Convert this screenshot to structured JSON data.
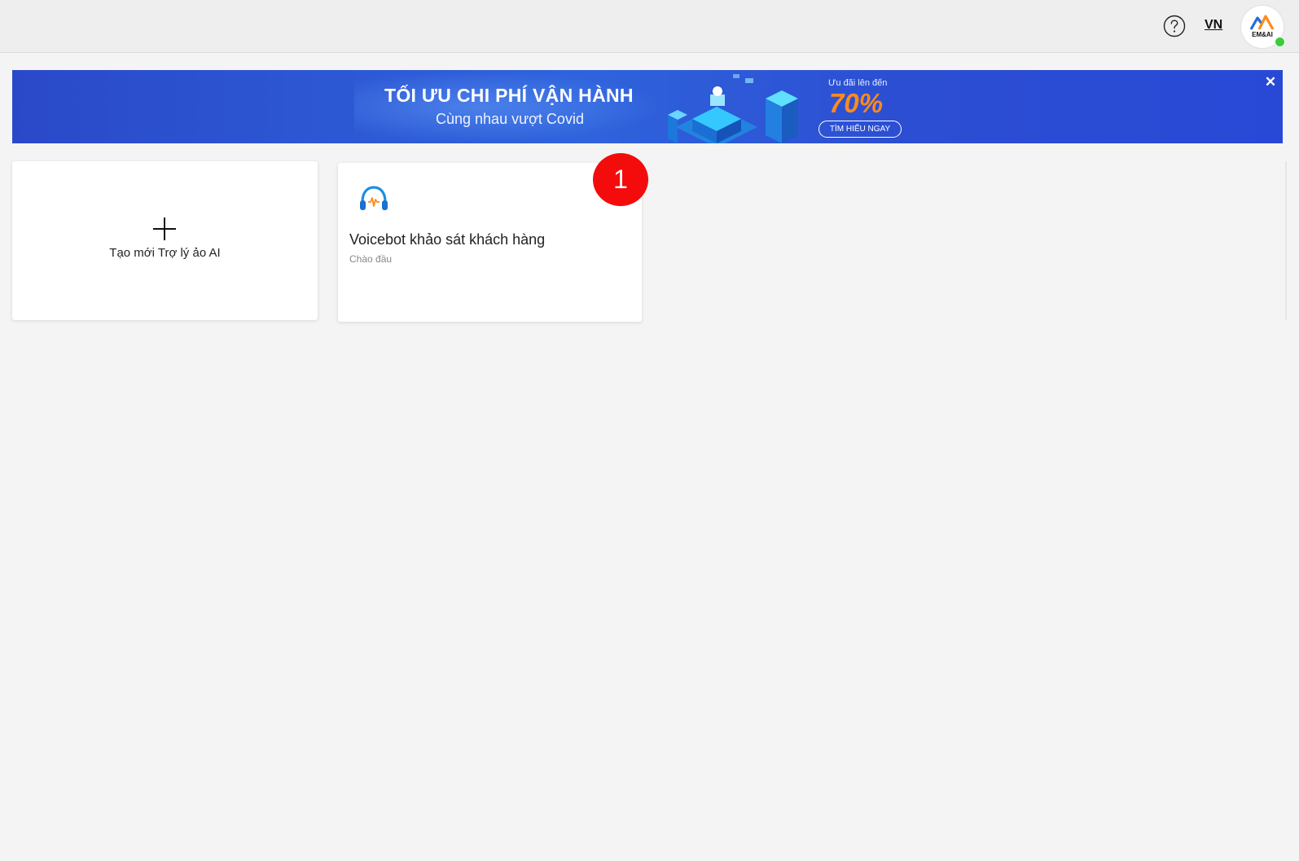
{
  "header": {
    "language": "VN",
    "avatar_text": "EM&AI"
  },
  "banner": {
    "title": "TỐI ƯU CHI PHÍ VẬN HÀNH",
    "subtitle": "Cùng nhau vượt Covid",
    "promo_label": "Ưu đãi lên đến",
    "promo_value": "70%",
    "cta_label": "TÌM HIỂU NGAY",
    "close_icon": "close-icon",
    "close_glyph": "✕"
  },
  "cards": {
    "create": {
      "label": "Tạo mới Trợ lý ảo AI",
      "icon": "plus-icon"
    },
    "bots": [
      {
        "name": "Voicebot khảo sát khách hàng",
        "subtitle": "Chào đầu",
        "icon": "headphones-icon",
        "badge": "1"
      }
    ]
  },
  "colors": {
    "badge": "#f40c0c",
    "promo": "#ff8a1e",
    "online": "#3ccc3c"
  }
}
